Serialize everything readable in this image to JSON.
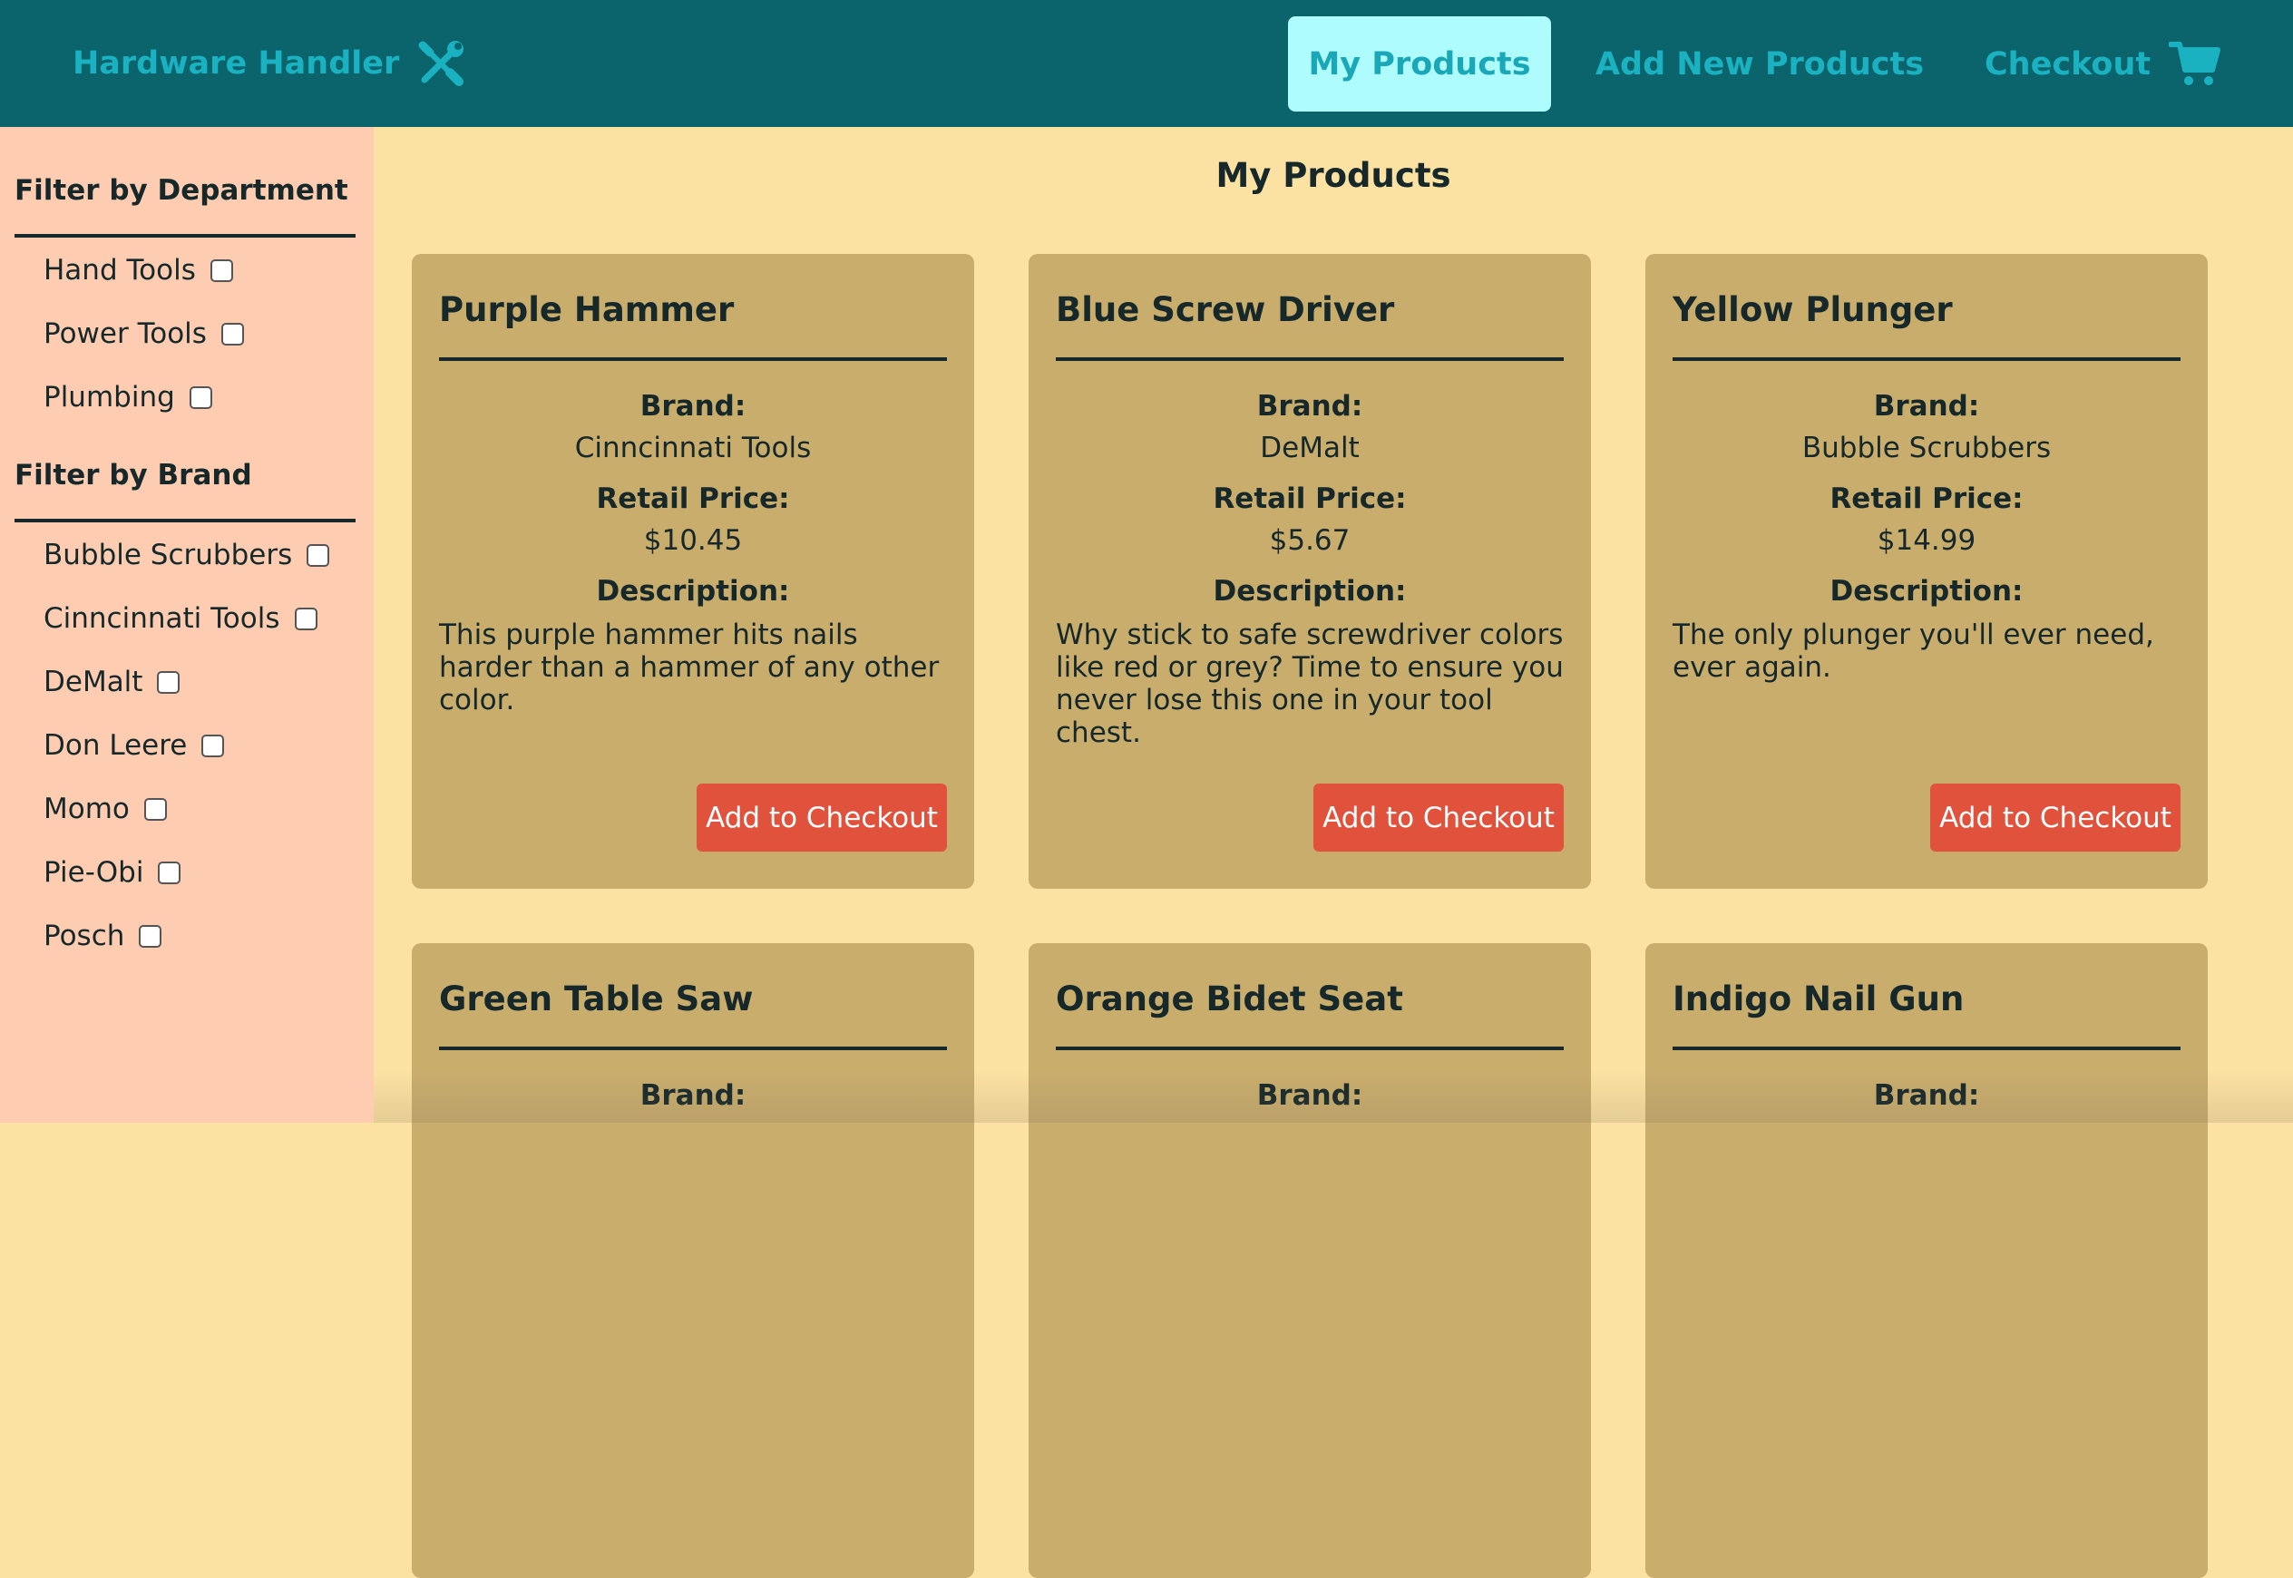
{
  "header": {
    "app_name": "Hardware Handler",
    "app_icon": "wrench-screwdriver-icon",
    "nav": [
      {
        "label": "My Products",
        "active": true
      },
      {
        "label": "Add New Products",
        "active": false
      },
      {
        "label": "Checkout",
        "active": false
      }
    ],
    "cart_icon": "cart-icon"
  },
  "sidebar": {
    "department_title": "Filter by Department",
    "departments": [
      "Hand Tools",
      "Power Tools",
      "Plumbing"
    ],
    "brand_title": "Filter by Brand",
    "brands": [
      "Bubble Scrubbers",
      "Cinncinnati Tools",
      "DeMalt",
      "Don Leere",
      "Momo",
      "Pie-Obi",
      "Posch"
    ]
  },
  "main": {
    "title": "My Products",
    "labels": {
      "brand": "Brand:",
      "retail_price": "Retail Price:",
      "description": "Description:",
      "add_button": "Add to Checkout"
    },
    "products": [
      {
        "name": "Purple Hammer",
        "brand": "Cinncinnati Tools",
        "price": "$10.45",
        "description": "This purple hammer hits nails harder than a hammer of any other color."
      },
      {
        "name": "Blue Screw Driver",
        "brand": "DeMalt",
        "price": "$5.67",
        "description": "Why stick to safe screwdriver colors like red or grey? Time to ensure you never lose this one in your tool chest."
      },
      {
        "name": "Yellow Plunger",
        "brand": "Bubble Scrubbers",
        "price": "$14.99",
        "description": "The only plunger you'll ever need, ever again."
      },
      {
        "name": "Green Table Saw"
      },
      {
        "name": "Orange Bidet Seat"
      },
      {
        "name": "Indigo Nail Gun"
      }
    ]
  },
  "colors": {
    "header_bg": "#0b636c",
    "accent": "#1ab1c1",
    "active_tab_bg": "#aefcfd",
    "sidebar_bg": "#fecdb1",
    "main_bg": "#fce2a2",
    "card_bg": "#c9ad6d",
    "button_bg": "#e1523c"
  }
}
